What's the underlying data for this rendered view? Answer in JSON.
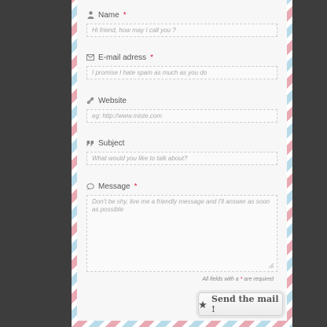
{
  "form": {
    "name": {
      "label": "Name",
      "required_mark": "*",
      "placeholder": "Hi friend, how may I call you ?",
      "icon": "person-icon"
    },
    "email": {
      "label": "E-mail adress",
      "required_mark": "*",
      "placeholder": "I promise I hate spam as much as you do",
      "icon": "envelope-icon"
    },
    "website": {
      "label": "Website",
      "placeholder": "eg: http://www.miste.com",
      "icon": "link-icon"
    },
    "subject": {
      "label": "Subject",
      "placeholder": "What would you like to talk about?",
      "icon": "quote-icon"
    },
    "message": {
      "label": "Message",
      "required_mark": "*",
      "placeholder": "Don't be shy, live me a friendly message and I'll answer as soon as possible",
      "icon": "speech-bubble-icon"
    },
    "required_note_prefix": "All fields with a",
    "required_note_mark": "*",
    "required_note_suffix": "are required",
    "send_label": "Send the mail !",
    "send_icon": "star-icon"
  },
  "colors": {
    "background": "#3d3d3d",
    "paper": "#f7f7f7",
    "stripe_red": "#e9a9b3",
    "stripe_blue": "#b8dbe9",
    "required": "#d61a3a"
  }
}
